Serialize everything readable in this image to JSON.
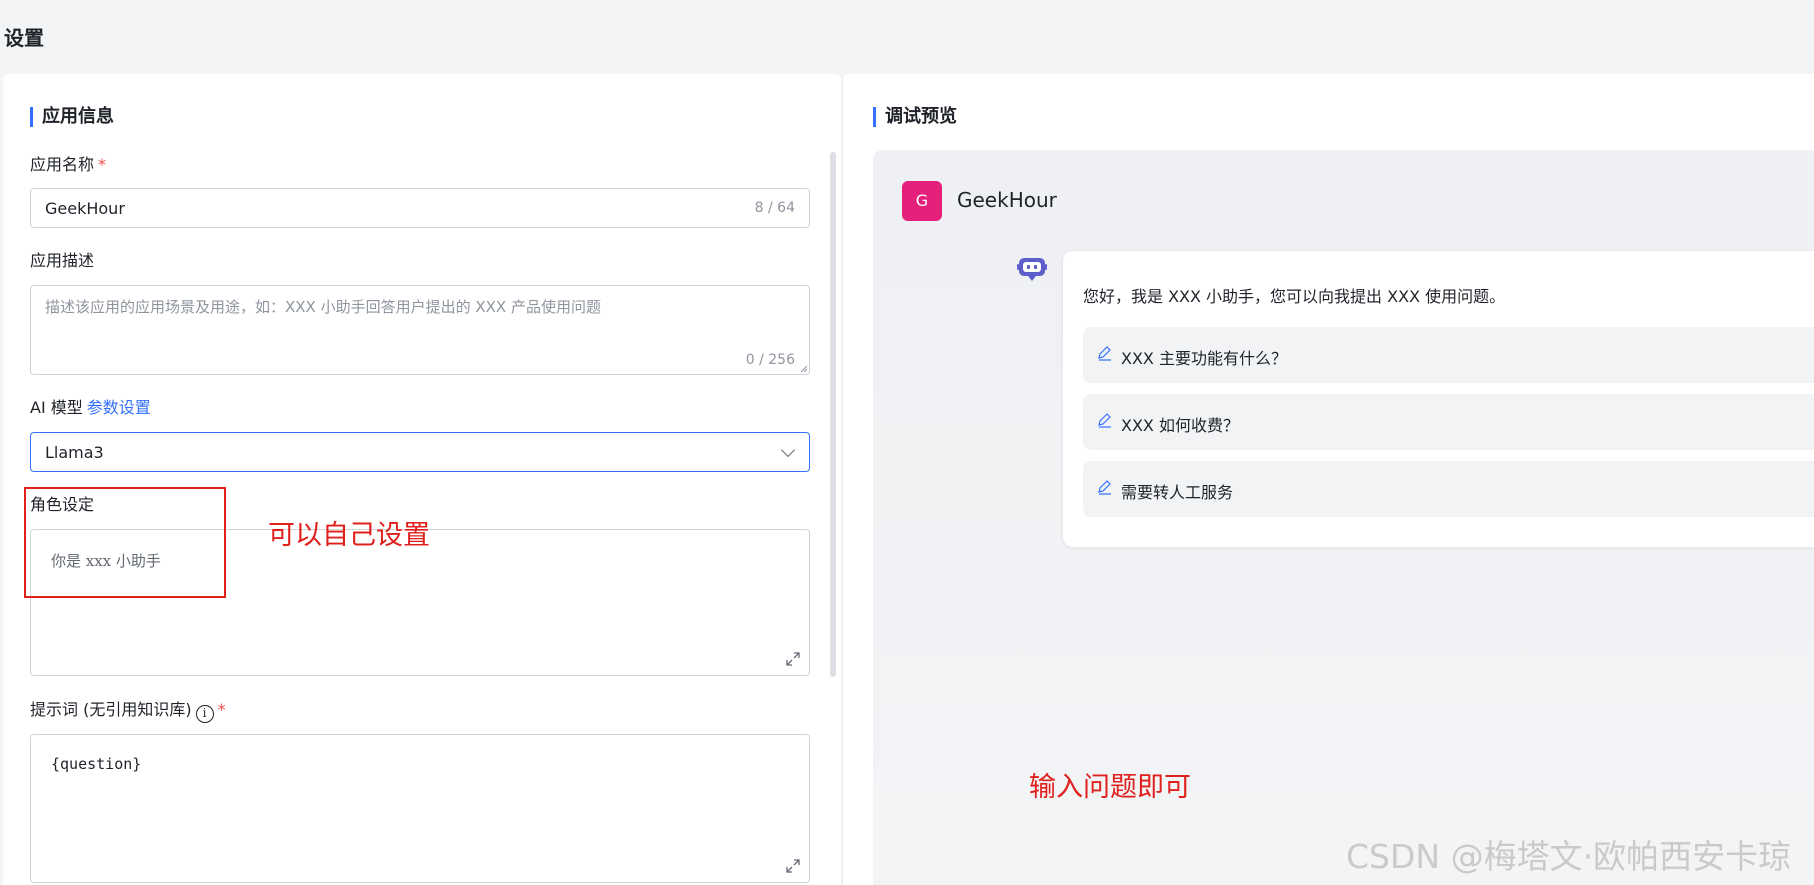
{
  "page": {
    "title": "设置"
  },
  "left": {
    "section_title": "应用信息",
    "app_name": {
      "label": "应用名称",
      "required": "*",
      "value": "GeekHour",
      "counter": "8 / 64"
    },
    "app_desc": {
      "label": "应用描述",
      "placeholder": "描述该应用的应用场景及用途，如：XXX 小助手回答用户提出的 XXX 产品使用问题",
      "counter": "0 / 256"
    },
    "ai_model": {
      "label": "AI 模型",
      "link": "参数设置",
      "value": "Llama3"
    },
    "role": {
      "label": "角色设定",
      "value": "你是 xxx 小助手"
    },
    "prompt": {
      "label": "提示词 (无引用知识库)",
      "info": "i",
      "required": "*",
      "value": "{question}"
    }
  },
  "right": {
    "section_title": "调试预览",
    "avatar_letter": "G",
    "app_name": "GeekHour",
    "greeting": "您好，我是 XXX 小助手，您可以向我提出 XXX 使用问题。",
    "suggestions": [
      "XXX 主要功能有什么？",
      "XXX 如何收费？",
      "需要转人工服务"
    ]
  },
  "annotations": {
    "role_note": "可以自己设置",
    "input_note": "输入问题即可"
  },
  "watermark": "CSDN @梅塔文·欧帕西安卡琼",
  "colors": {
    "accent": "#3370ff",
    "annotation": "#e0201c",
    "avatar": "#e4207b"
  },
  "icons": [
    "chevron-down-icon",
    "expand-icon",
    "info-icon",
    "bot-icon",
    "pen-icon"
  ]
}
